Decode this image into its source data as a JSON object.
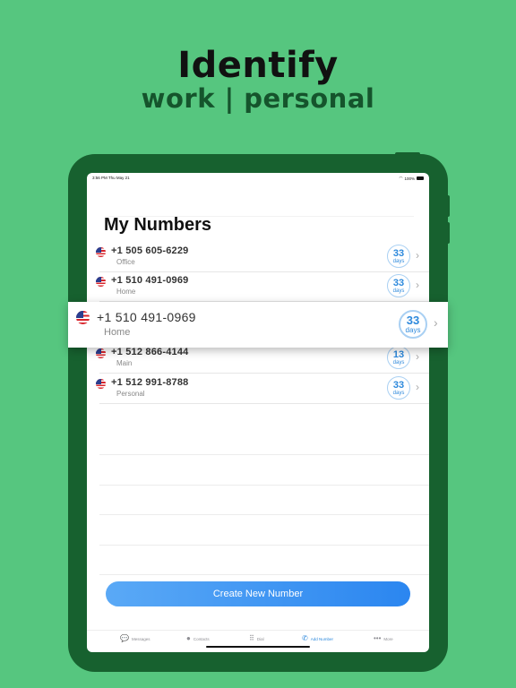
{
  "headline": "Identify",
  "subline": "work | personal",
  "status": {
    "time": "3:56 PM  Thu May 21",
    "battery": "100%"
  },
  "screen": {
    "title": "My Numbers",
    "rows": [
      {
        "number": "+1 505 605-6229",
        "label": "Office",
        "days": "33",
        "days_unit": "days"
      },
      {
        "number": "+1 510 491-0969",
        "label": "Home",
        "days": "33",
        "days_unit": "days"
      },
      {
        "number": "+1 512 866-4144",
        "label": "Main",
        "days": "13",
        "days_unit": "days"
      },
      {
        "number": "+1 512 991-8788",
        "label": "Personal",
        "days": "33",
        "days_unit": "days"
      }
    ],
    "cta": "Create New Number"
  },
  "highlight": {
    "number": "+1 510 491-0969",
    "label": "Home",
    "days": "33",
    "days_unit": "days"
  },
  "tabs": [
    {
      "label": "Messages",
      "icon": "messages-icon"
    },
    {
      "label": "Contacts",
      "icon": "contacts-icon"
    },
    {
      "label": "Dial",
      "icon": "dialpad-icon"
    },
    {
      "label": "Add Number",
      "icon": "add-number-icon"
    },
    {
      "label": "More",
      "icon": "more-icon"
    }
  ],
  "colors": {
    "background": "#56c67f",
    "device": "#17612f",
    "accent": "#2d89dc",
    "subline": "#15542c"
  }
}
